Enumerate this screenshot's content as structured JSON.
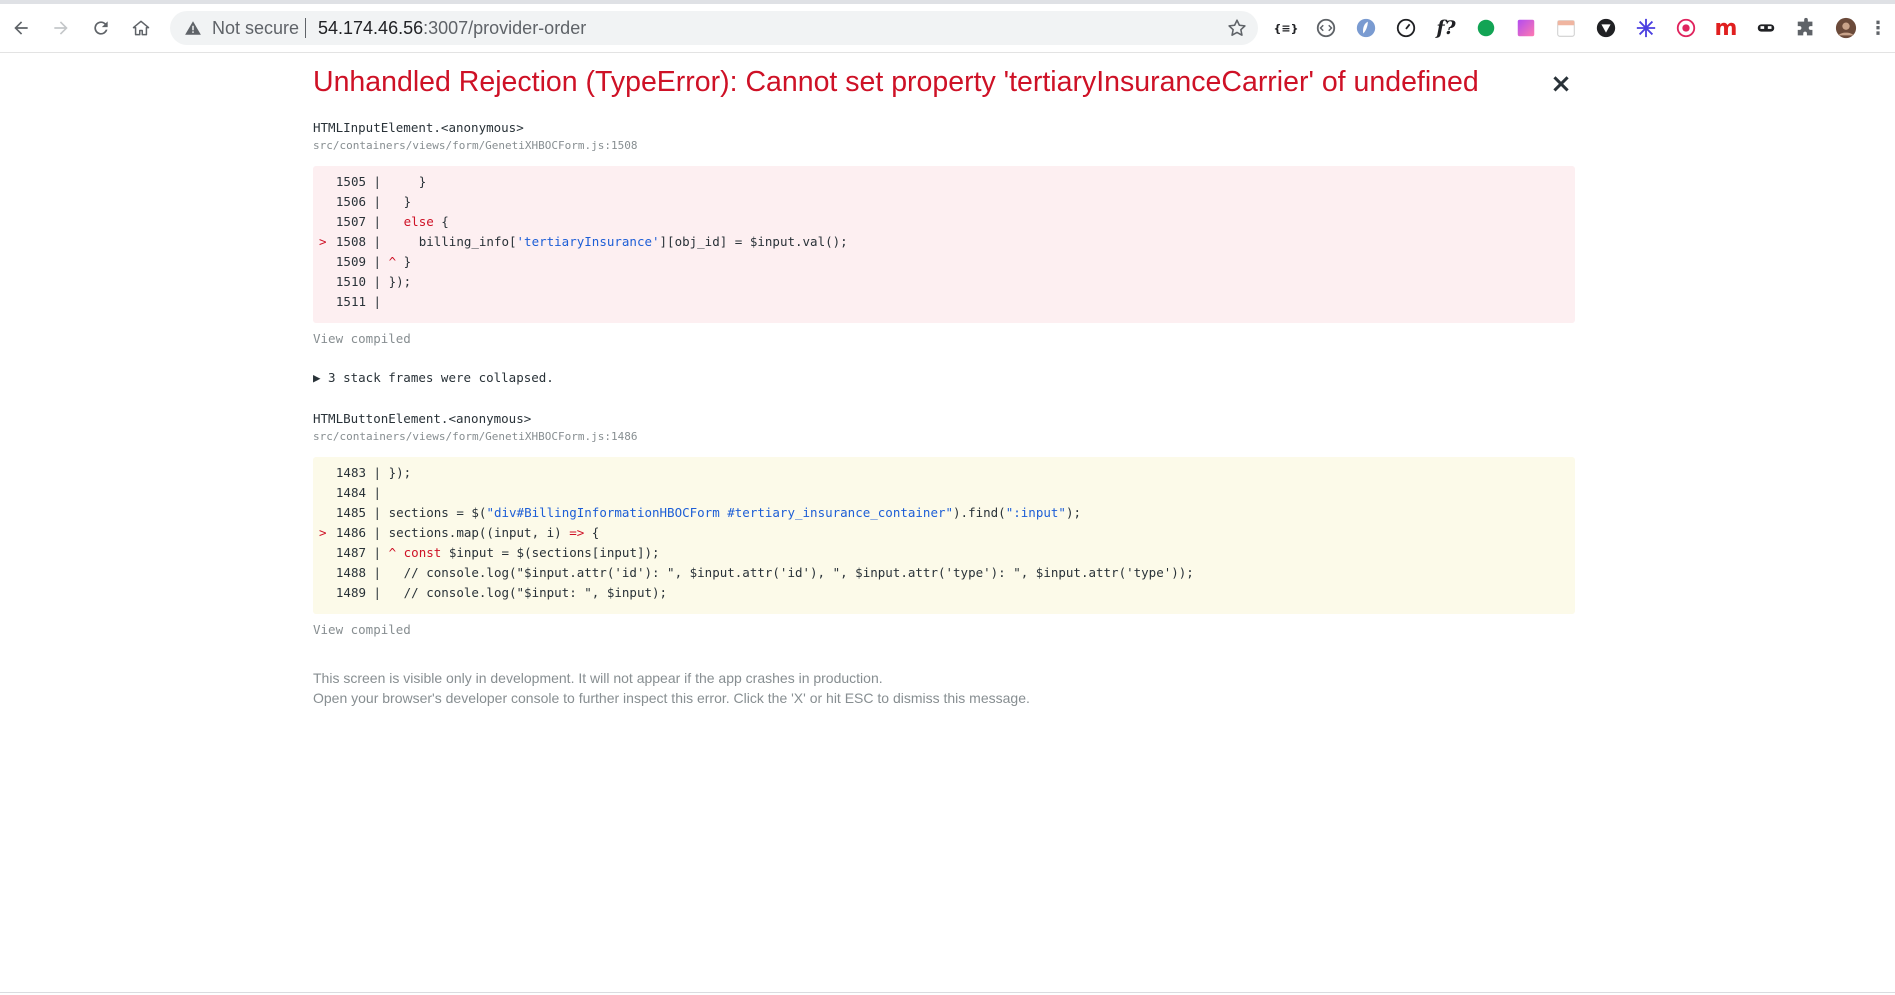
{
  "browser": {
    "security_status": "Not secure",
    "url_host": "54.174.46.56",
    "url_rest": ":3007/provider-order",
    "extensions": [
      {
        "icon": "json-viewer-icon",
        "glyph": "{≡}"
      },
      {
        "icon": "code-icon",
        "glyph": "⟨·⟩"
      },
      {
        "icon": "shield-blue-icon",
        "glyph": ""
      },
      {
        "icon": "speedometer-icon",
        "glyph": ""
      },
      {
        "icon": "function-icon",
        "glyph": "f?"
      },
      {
        "icon": "green-dot-icon",
        "glyph": ""
      },
      {
        "icon": "gradient-square-icon",
        "glyph": ""
      },
      {
        "icon": "calendar-icon",
        "glyph": ""
      },
      {
        "icon": "vpn-icon",
        "glyph": ""
      },
      {
        "icon": "snowflake-icon",
        "glyph": "❄"
      },
      {
        "icon": "target-icon",
        "glyph": ""
      },
      {
        "icon": "m-logo-icon",
        "glyph": "m"
      },
      {
        "icon": "mask-icon",
        "glyph": ""
      },
      {
        "icon": "puzzle-icon",
        "glyph": ""
      },
      {
        "icon": "avatar-icon",
        "glyph": ""
      }
    ]
  },
  "error": {
    "title": "Unhandled Rejection (TypeError): Cannot set property 'tertiaryInsuranceCarrier' of undefined",
    "close_glyph": "×",
    "frames": [
      {
        "function": "HTMLInputElement.<anonymous>",
        "file": "src/containers/views/form/GenetiXHBOCForm.js:1508",
        "color": "#fdeff1",
        "lines": [
          {
            "num": "1505",
            "marker": "",
            "bar": "|",
            "caret": "",
            "segments": [
              {
                "t": "    }",
                "c": ""
              }
            ]
          },
          {
            "num": "1506",
            "marker": "",
            "bar": "|",
            "caret": "",
            "segments": [
              {
                "t": "  }",
                "c": ""
              }
            ]
          },
          {
            "num": "1507",
            "marker": "",
            "bar": "|",
            "caret": "",
            "segments": [
              {
                "t": "  ",
                "c": ""
              },
              {
                "t": "else",
                "c": "kw"
              },
              {
                "t": " {",
                "c": ""
              }
            ]
          },
          {
            "num": "1508",
            "marker": ">",
            "bar": "|",
            "caret": "",
            "segments": [
              {
                "t": "    billing_info[",
                "c": ""
              },
              {
                "t": "'tertiaryInsurance'",
                "c": "str"
              },
              {
                "t": "][obj_id] = $input.val();",
                "c": ""
              }
            ]
          },
          {
            "num": "1509",
            "marker": "",
            "bar": "|",
            "caret": "^",
            "segments": [
              {
                "t": " }",
                "c": ""
              }
            ]
          },
          {
            "num": "1510",
            "marker": "",
            "bar": "|",
            "caret": "",
            "segments": [
              {
                "t": "});",
                "c": ""
              }
            ]
          },
          {
            "num": "1511",
            "marker": "",
            "bar": "|",
            "caret": "",
            "segments": []
          }
        ],
        "view_compiled": "View compiled"
      },
      {
        "function": "HTMLButtonElement.<anonymous>",
        "file": "src/containers/views/form/GenetiXHBOCForm.js:1486",
        "color": "#fcfae9",
        "lines": [
          {
            "num": "1483",
            "marker": "",
            "bar": "|",
            "caret": "",
            "segments": [
              {
                "t": "});",
                "c": ""
              }
            ]
          },
          {
            "num": "1484",
            "marker": "",
            "bar": "|",
            "caret": "",
            "segments": []
          },
          {
            "num": "1485",
            "marker": "",
            "bar": "|",
            "caret": "",
            "segments": [
              {
                "t": "sections = $(",
                "c": ""
              },
              {
                "t": "\"div#BillingInformationHBOCForm #tertiary_insurance_container\"",
                "c": "str"
              },
              {
                "t": ").find(",
                "c": ""
              },
              {
                "t": "\":input\"",
                "c": "str"
              },
              {
                "t": ");",
                "c": ""
              }
            ]
          },
          {
            "num": "1486",
            "marker": ">",
            "bar": "|",
            "caret": "",
            "segments": [
              {
                "t": "sections.map((input, i) ",
                "c": ""
              },
              {
                "t": "=>",
                "c": "kw"
              },
              {
                "t": " {",
                "c": ""
              }
            ]
          },
          {
            "num": "1487",
            "marker": "",
            "bar": "|",
            "caret": "^",
            "segments": [
              {
                "t": " ",
                "c": ""
              },
              {
                "t": "const",
                "c": "kw"
              },
              {
                "t": " $input = $(sections[input]);",
                "c": ""
              }
            ]
          },
          {
            "num": "1488",
            "marker": "",
            "bar": "|",
            "caret": "",
            "segments": [
              {
                "t": "  // console.log(\"$input.attr('id'): \", $input.attr('id'), \", $input.attr('type'): \", $input.attr('type'));",
                "c": ""
              }
            ]
          },
          {
            "num": "1489",
            "marker": "",
            "bar": "|",
            "caret": "",
            "segments": [
              {
                "t": "  // console.log(\"$input: \", $input);",
                "c": ""
              }
            ]
          }
        ],
        "view_compiled": "View compiled"
      }
    ],
    "collapsed_text": "▶ 3 stack frames were collapsed.",
    "footer_line1": "This screen is visible only in development. It will not appear if the app crashes in production.",
    "footer_line2": "Open your browser's developer console to further inspect this error.  Click the 'X' or hit ESC to dismiss this message."
  }
}
